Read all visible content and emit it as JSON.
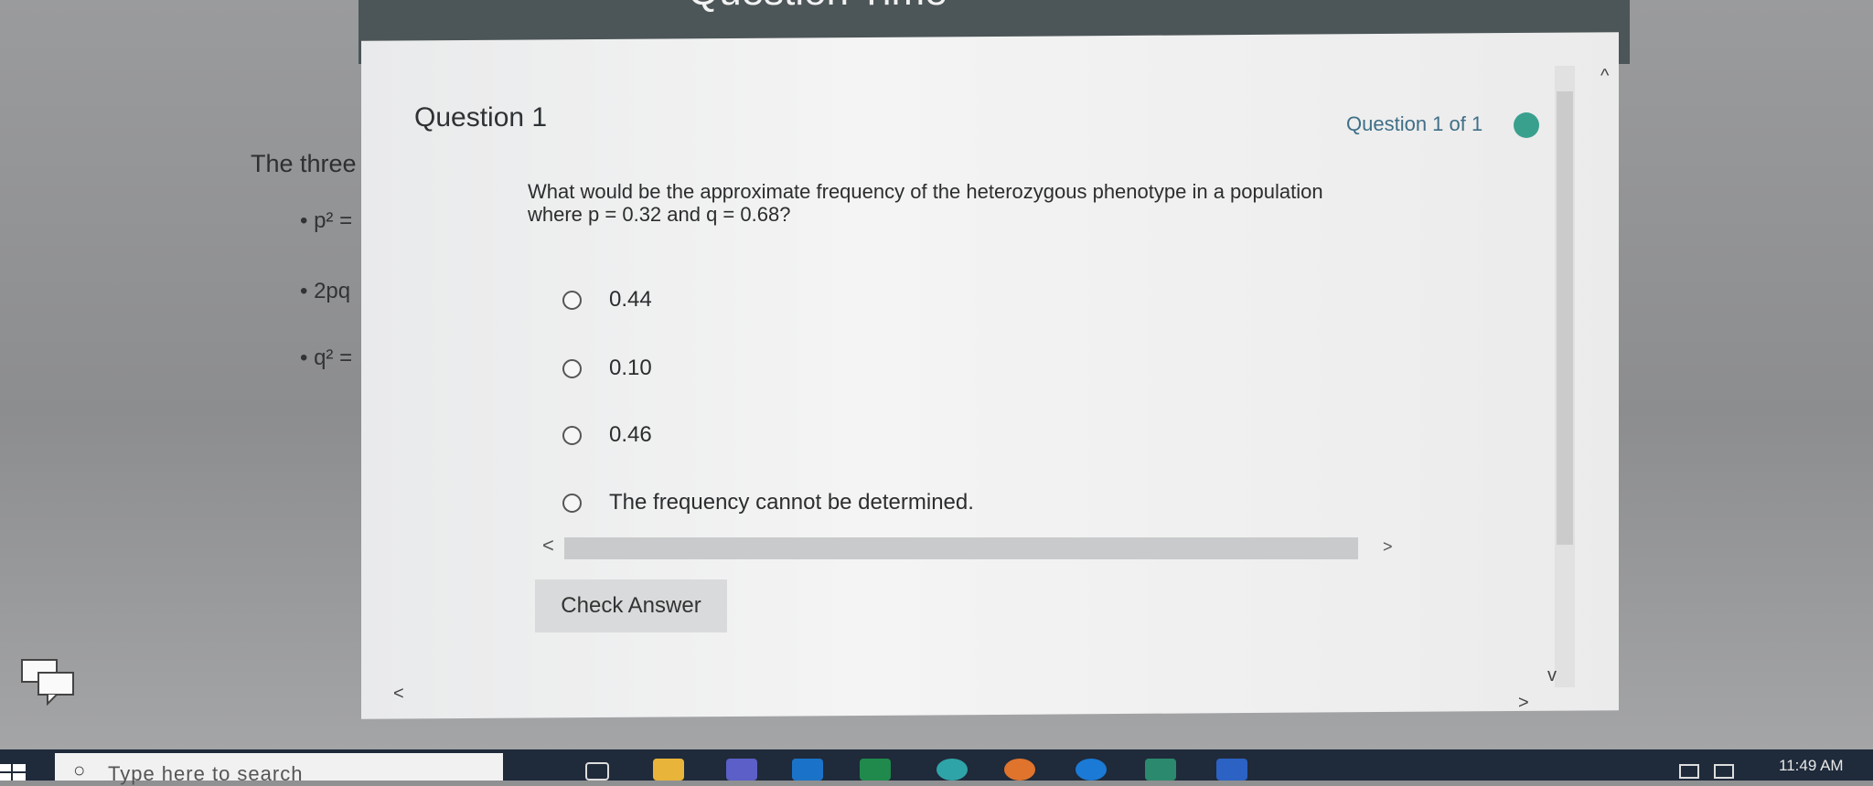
{
  "modal": {
    "title": "Question Time",
    "close_icon": "close-icon"
  },
  "background_page": {
    "intro_text": "The three",
    "bullets": [
      "p² =",
      "2pq",
      "q² ="
    ]
  },
  "question": {
    "heading": "Question 1",
    "progress": "Question 1 of 1",
    "progress_dot_color": "#3aa08e",
    "text_line1": "What would be the approximate frequency of the heterozygous phenotype in a population",
    "text_line2": "where p = 0.32 and q = 0.68?",
    "options": [
      "0.44",
      "0.10",
      "0.46",
      "The frequency cannot be determined."
    ],
    "selected": null
  },
  "actions": {
    "check_answer_label": "Check Answer"
  },
  "taskbar": {
    "search_placeholder": "Type here to search",
    "clock": "11:49 AM",
    "icons": [
      "task-view-icon",
      "file-explorer-icon",
      "teams-icon",
      "outlook-icon",
      "excel-icon",
      "edge-icon",
      "firefox-icon",
      "chrome-canary-icon",
      "publisher-icon",
      "word-icon"
    ]
  },
  "colors": {
    "modal_header": "#4c5557",
    "progress_text": "#3f6f87",
    "taskbar": "#1f2a3a"
  }
}
